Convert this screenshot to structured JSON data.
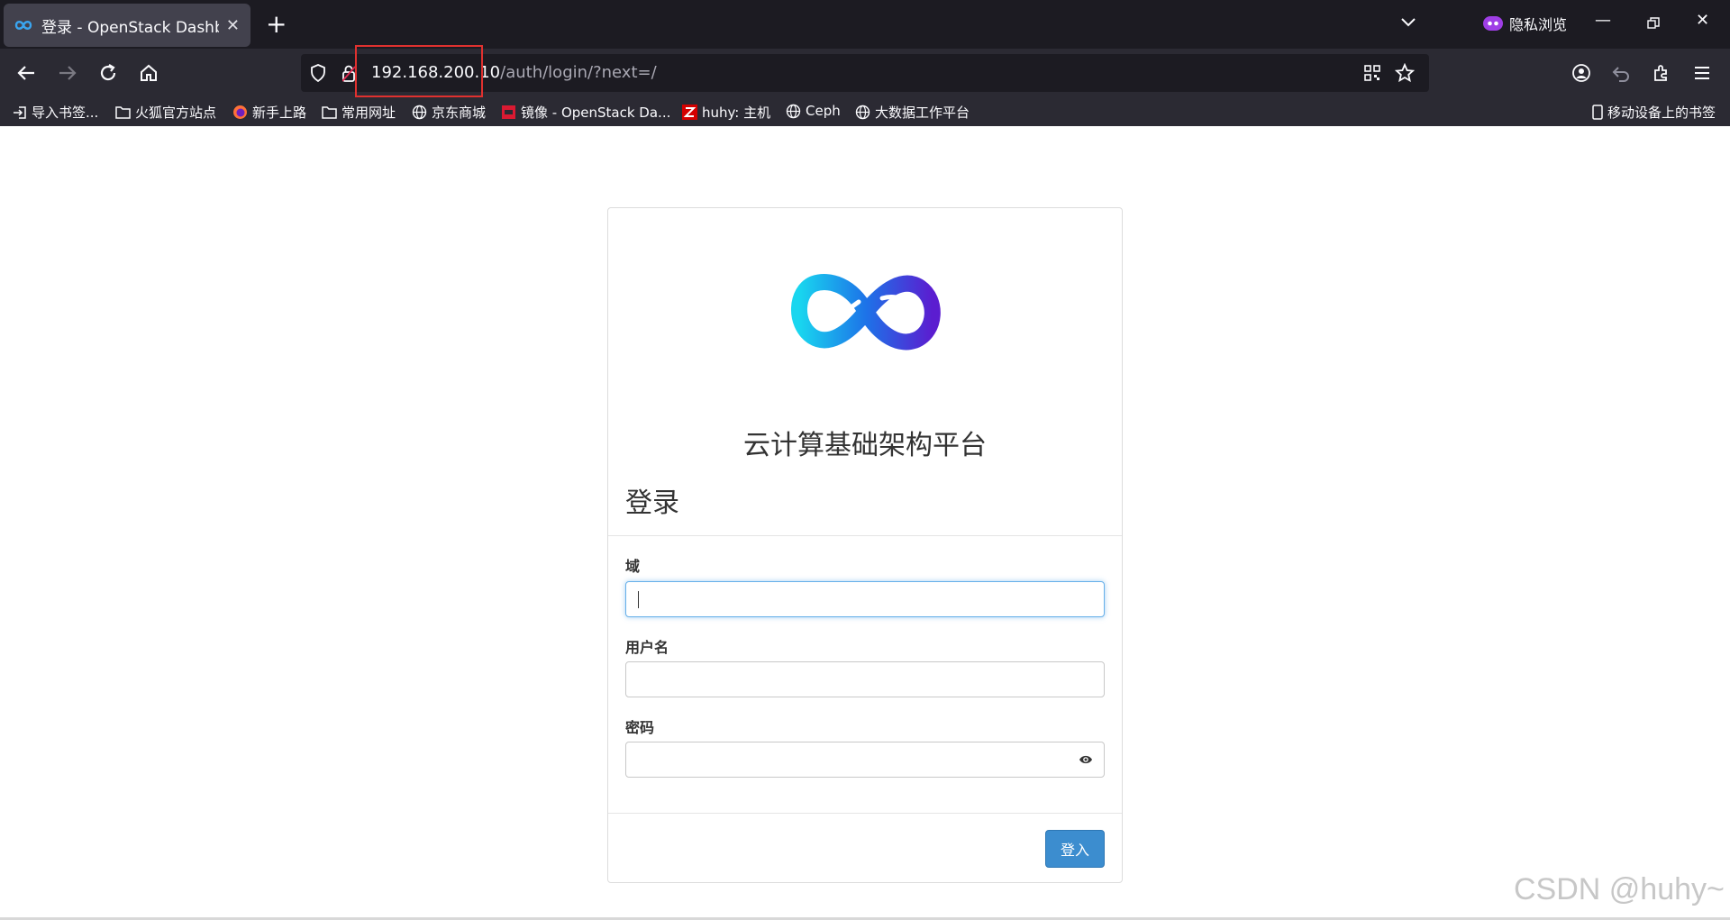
{
  "browser": {
    "tab_title": "登录 - OpenStack Dashboard",
    "private_label": "隐私浏览",
    "url_host": "192.168.200.10",
    "url_path": "/auth/login/?next=/"
  },
  "bookmarks": [
    {
      "label": "导入书签..."
    },
    {
      "label": "火狐官方站点"
    },
    {
      "label": "新手上路"
    },
    {
      "label": "常用网址"
    },
    {
      "label": "京东商城"
    },
    {
      "label": "镜像 - OpenStack Da..."
    },
    {
      "label": "huhy: 主机"
    },
    {
      "label": "Ceph"
    },
    {
      "label": "大数据工作平台"
    }
  ],
  "mobile_bookmarks": "移动设备上的书签",
  "login": {
    "brand": "云计算基础架构平台",
    "heading": "登录",
    "domain_label": "域",
    "domain_value": "",
    "username_label": "用户名",
    "username_value": "",
    "password_label": "密码",
    "password_value": "",
    "submit_label": "登入"
  },
  "watermark": "CSDN @huhy~",
  "colors": {
    "chrome_dark": "#1c1b22",
    "chrome_toolbar": "#2b2a33",
    "accent_button": "#3c8dcf",
    "highlight_box": "#e0312f"
  }
}
